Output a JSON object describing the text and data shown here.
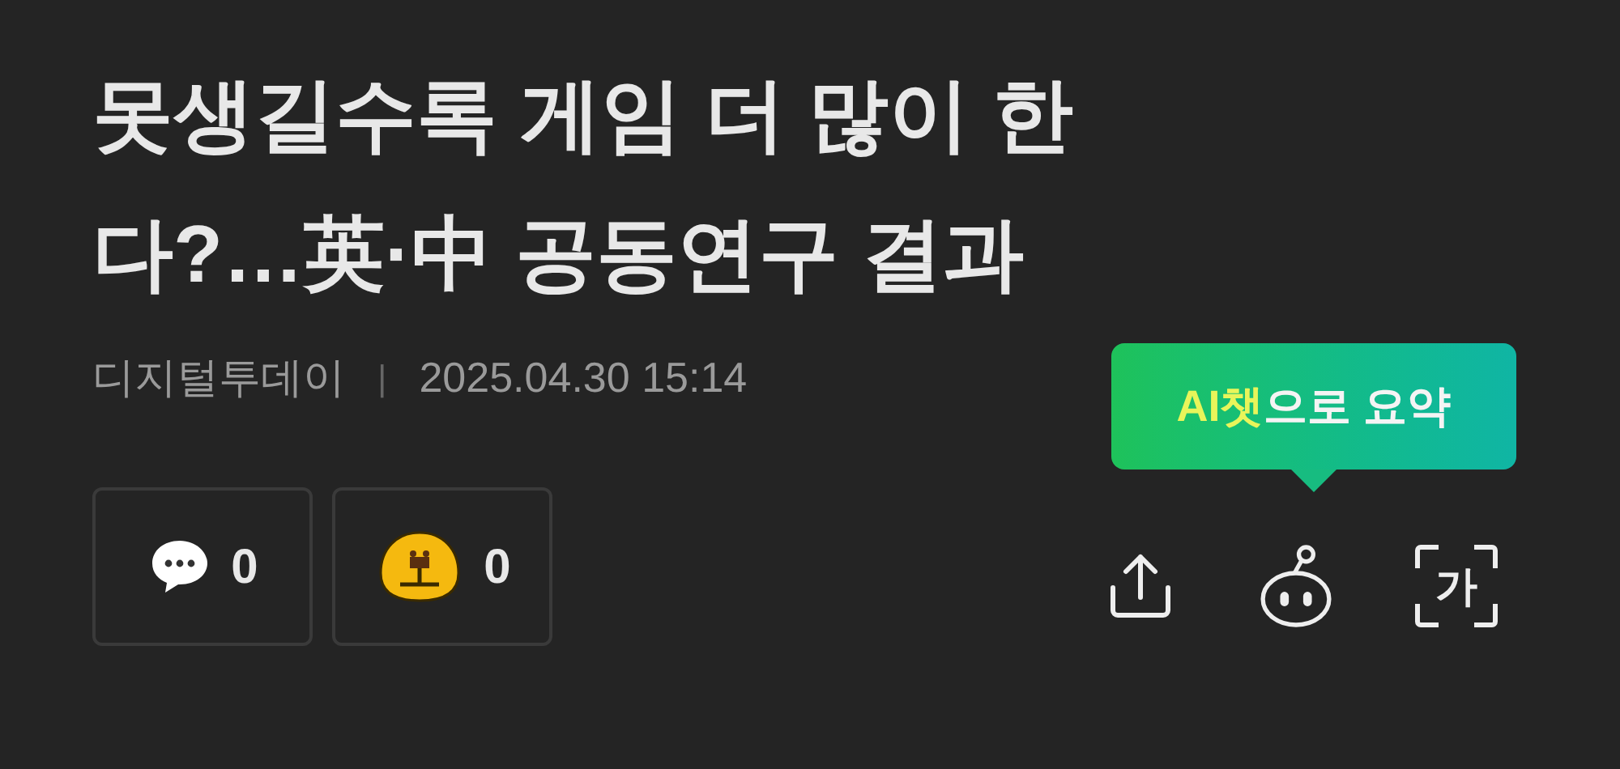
{
  "headline": "못생길수록 게임 더 많이 한다?…英·中 공동연구 결과",
  "meta": {
    "source": "디지털투데이",
    "separator": "|",
    "datetime": "2025.04.30 15:14"
  },
  "reactions": [
    {
      "kind": "comment",
      "count": "0"
    },
    {
      "kind": "emoji",
      "count": "0"
    }
  ],
  "tooltip": {
    "highlight": "AI챗",
    "rest": "으로 요약"
  },
  "toolbar": [
    {
      "kind": "share"
    },
    {
      "kind": "bot"
    },
    {
      "kind": "translate",
      "glyph": "가"
    }
  ]
}
